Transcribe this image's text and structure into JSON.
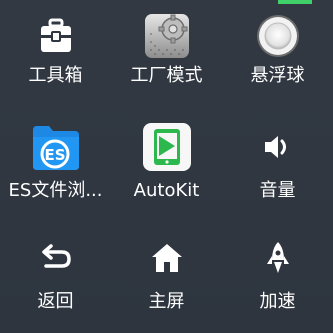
{
  "menu": {
    "items": [
      {
        "label": "工具箱",
        "icon": "toolbox-icon"
      },
      {
        "label": "工厂模式",
        "icon": "factory-gear-icon"
      },
      {
        "label": "悬浮球",
        "icon": "floating-ball-icon"
      },
      {
        "label": "ES文件浏...",
        "icon": "es-file-explorer-icon"
      },
      {
        "label": "AutoKit",
        "icon": "autokit-icon"
      },
      {
        "label": "音量",
        "icon": "volume-icon"
      },
      {
        "label": "返回",
        "icon": "back-icon"
      },
      {
        "label": "主屏",
        "icon": "home-icon"
      },
      {
        "label": "加速",
        "icon": "rocket-icon"
      }
    ]
  },
  "colors": {
    "background": "#2f3640",
    "text": "#ffffff",
    "es_blue": "#1e88e5",
    "autokit_green": "#2db84d",
    "accent_green": "#3fd06a"
  }
}
